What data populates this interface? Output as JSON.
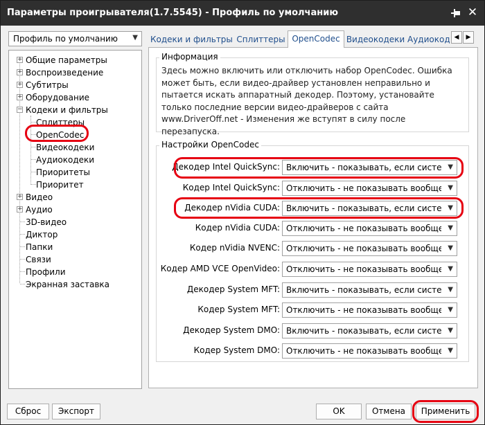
{
  "window": {
    "title": "Параметры проигрывателя(1.7.5545) - Профиль по умолчанию"
  },
  "profile_select": {
    "value": "Профиль по умолчанию"
  },
  "tree": {
    "items": [
      "Общие параметры",
      "Воспроизведение",
      "Субтитры",
      "Оборудование",
      "Кодеки и фильтры",
      "Сплиттеры",
      "OpenCodec",
      "Видеокодеки",
      "Аудиокодеки",
      "Приоритеты",
      "Приоритет",
      "Видео",
      "Аудио",
      "3D-видео",
      "Диктор",
      "Папки",
      "Связи",
      "Профили",
      "Экранная заставка"
    ]
  },
  "tabs": [
    "Кодеки и фильтры",
    "Сплиттеры",
    "OpenCodec",
    "Видеокодеки",
    "Аудиокод"
  ],
  "info_group": {
    "title": "Информация",
    "text": "Здесь можно включить или отключить набор OpenCodec. Ошибка может быть, если видео-драйвер установлен неправильно и пытается искать аппаратный декодер. Поэтому, установайте только последние версии видео-драйверов с сайта www.DriverOff.net - Изменения же вступят в силу после перезапуска."
  },
  "settings_group": {
    "title": "Настройки OpenCodec",
    "rows": [
      {
        "label": "Декодер Intel QuickSync:",
        "value": "Включить - показывать, если система по"
      },
      {
        "label": "Кодер Intel QuickSync:",
        "value": "Отключить - не показывать вообще (рек"
      },
      {
        "label": "Декодер nVidia CUDA:",
        "value": "Включить - показывать, если система по"
      },
      {
        "label": "Кодер nVidia CUDA:",
        "value": "Отключить - не показывать вообще (рек"
      },
      {
        "label": "Кодер nVidia NVENC:",
        "value": "Отключить - не показывать вообще (рек"
      },
      {
        "label": "Кодер AMD VCE OpenVideo:",
        "value": "Отключить - не показывать вообще (рек"
      },
      {
        "label": "Декодер System MFT:",
        "value": "Включить - показывать, если система по"
      },
      {
        "label": "Кодер System MFT:",
        "value": "Отключить - не показывать вообще (рек"
      },
      {
        "label": "Декодер System DMO:",
        "value": "Включить - показывать, если система по"
      },
      {
        "label": "Кодер System DMO:",
        "value": "Отключить - не показывать вообще (рек"
      }
    ]
  },
  "buttons": {
    "reset": "Сброс",
    "export": "Экспорт",
    "ok": "OK",
    "cancel": "Отмена",
    "apply": "Применить"
  },
  "colors": {
    "titlebar": "#2f2f2f",
    "highlight": "#e60012",
    "tab_text": "#1f4e8c"
  }
}
